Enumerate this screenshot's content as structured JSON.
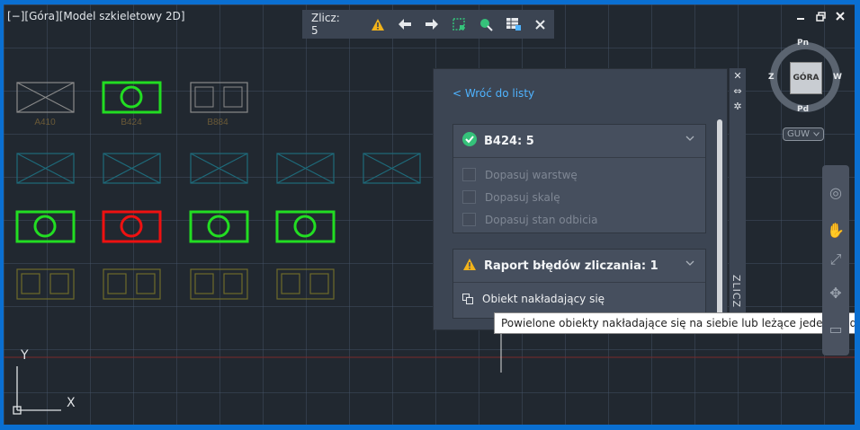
{
  "viewport": {
    "label": "[−][Góra][Model szkieletowy 2D]"
  },
  "window_controls": {
    "minimize_icon": "minimize-icon",
    "restore_icon": "restore-icon",
    "close_icon": "close-icon"
  },
  "toolbar": {
    "count_label": "Zlicz:",
    "count_value": "5",
    "icons": [
      "warning-icon",
      "previous-arrow-icon",
      "next-arrow-icon",
      "select-objects-icon",
      "zoom-object-icon",
      "insert-table-icon",
      "close-icon"
    ]
  },
  "drawing": {
    "block_labels": [
      "A410",
      "B424",
      "B884"
    ]
  },
  "palette": {
    "back_link": "< Wróć do listy",
    "block_card": {
      "title": "B424: 5",
      "options": [
        "Dopasuj warstwę",
        "Dopasuj skalę",
        "Dopasuj stan odbicia"
      ]
    },
    "error_card": {
      "title": "Raport błędów zliczania: 1",
      "item": "Obiekt nakładający się"
    },
    "side_title": "ZLICZ"
  },
  "tooltip": {
    "text": "Powielone obiekty nakładające się na siebie lub leżące jeden na drugim"
  },
  "viewcube": {
    "top_label": "GÓRA",
    "north": "Pn",
    "south": "Pd",
    "west": "Z",
    "east": "W",
    "ucs_menu": "GUW"
  },
  "ucs": {
    "x": "X",
    "y": "Y"
  },
  "colors": {
    "accent_link": "#4fb3ff",
    "block_green": "#22dd22",
    "block_red": "#ee1111",
    "success": "#35c27a",
    "warning": "#f2b31a"
  }
}
